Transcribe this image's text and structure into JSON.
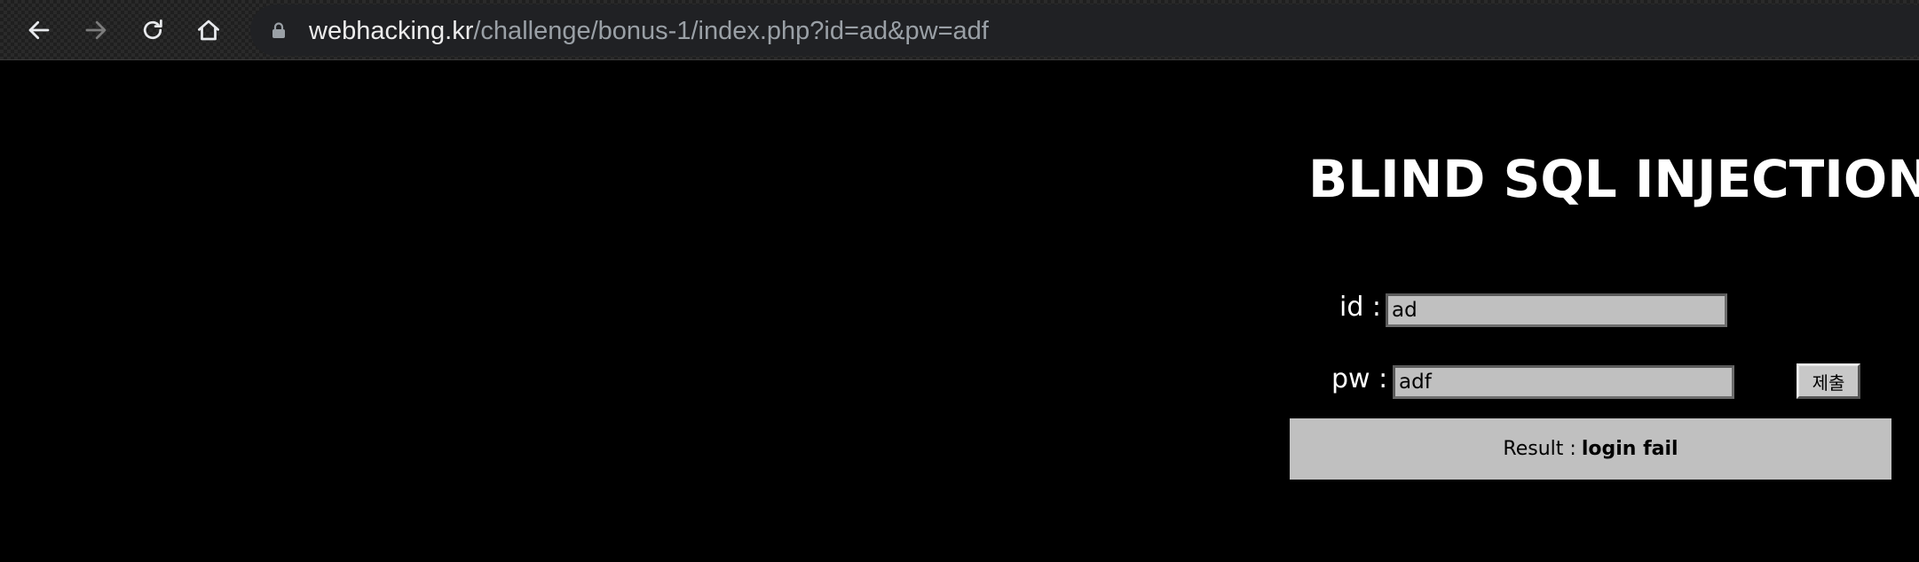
{
  "browser": {
    "url_domain": "webhacking.kr",
    "url_path": "/challenge/bonus-1/index.php?id=ad&pw=adf",
    "icons": [
      "back-arrow-icon",
      "forward-arrow-icon",
      "reload-icon",
      "home-icon",
      "lock-icon"
    ]
  },
  "page": {
    "title": "BLIND SQL INJECTION",
    "id_label": "id :",
    "id_value": "ad",
    "pw_label": "pw :",
    "pw_value": "adf",
    "submit_label": "제출",
    "result_label": "Result :",
    "result_value": "login fail"
  },
  "colors": {
    "page_background": "#000000",
    "input_background": "#c0c0c0",
    "result_background": "#c0c0c0",
    "text": "#ffffff"
  }
}
